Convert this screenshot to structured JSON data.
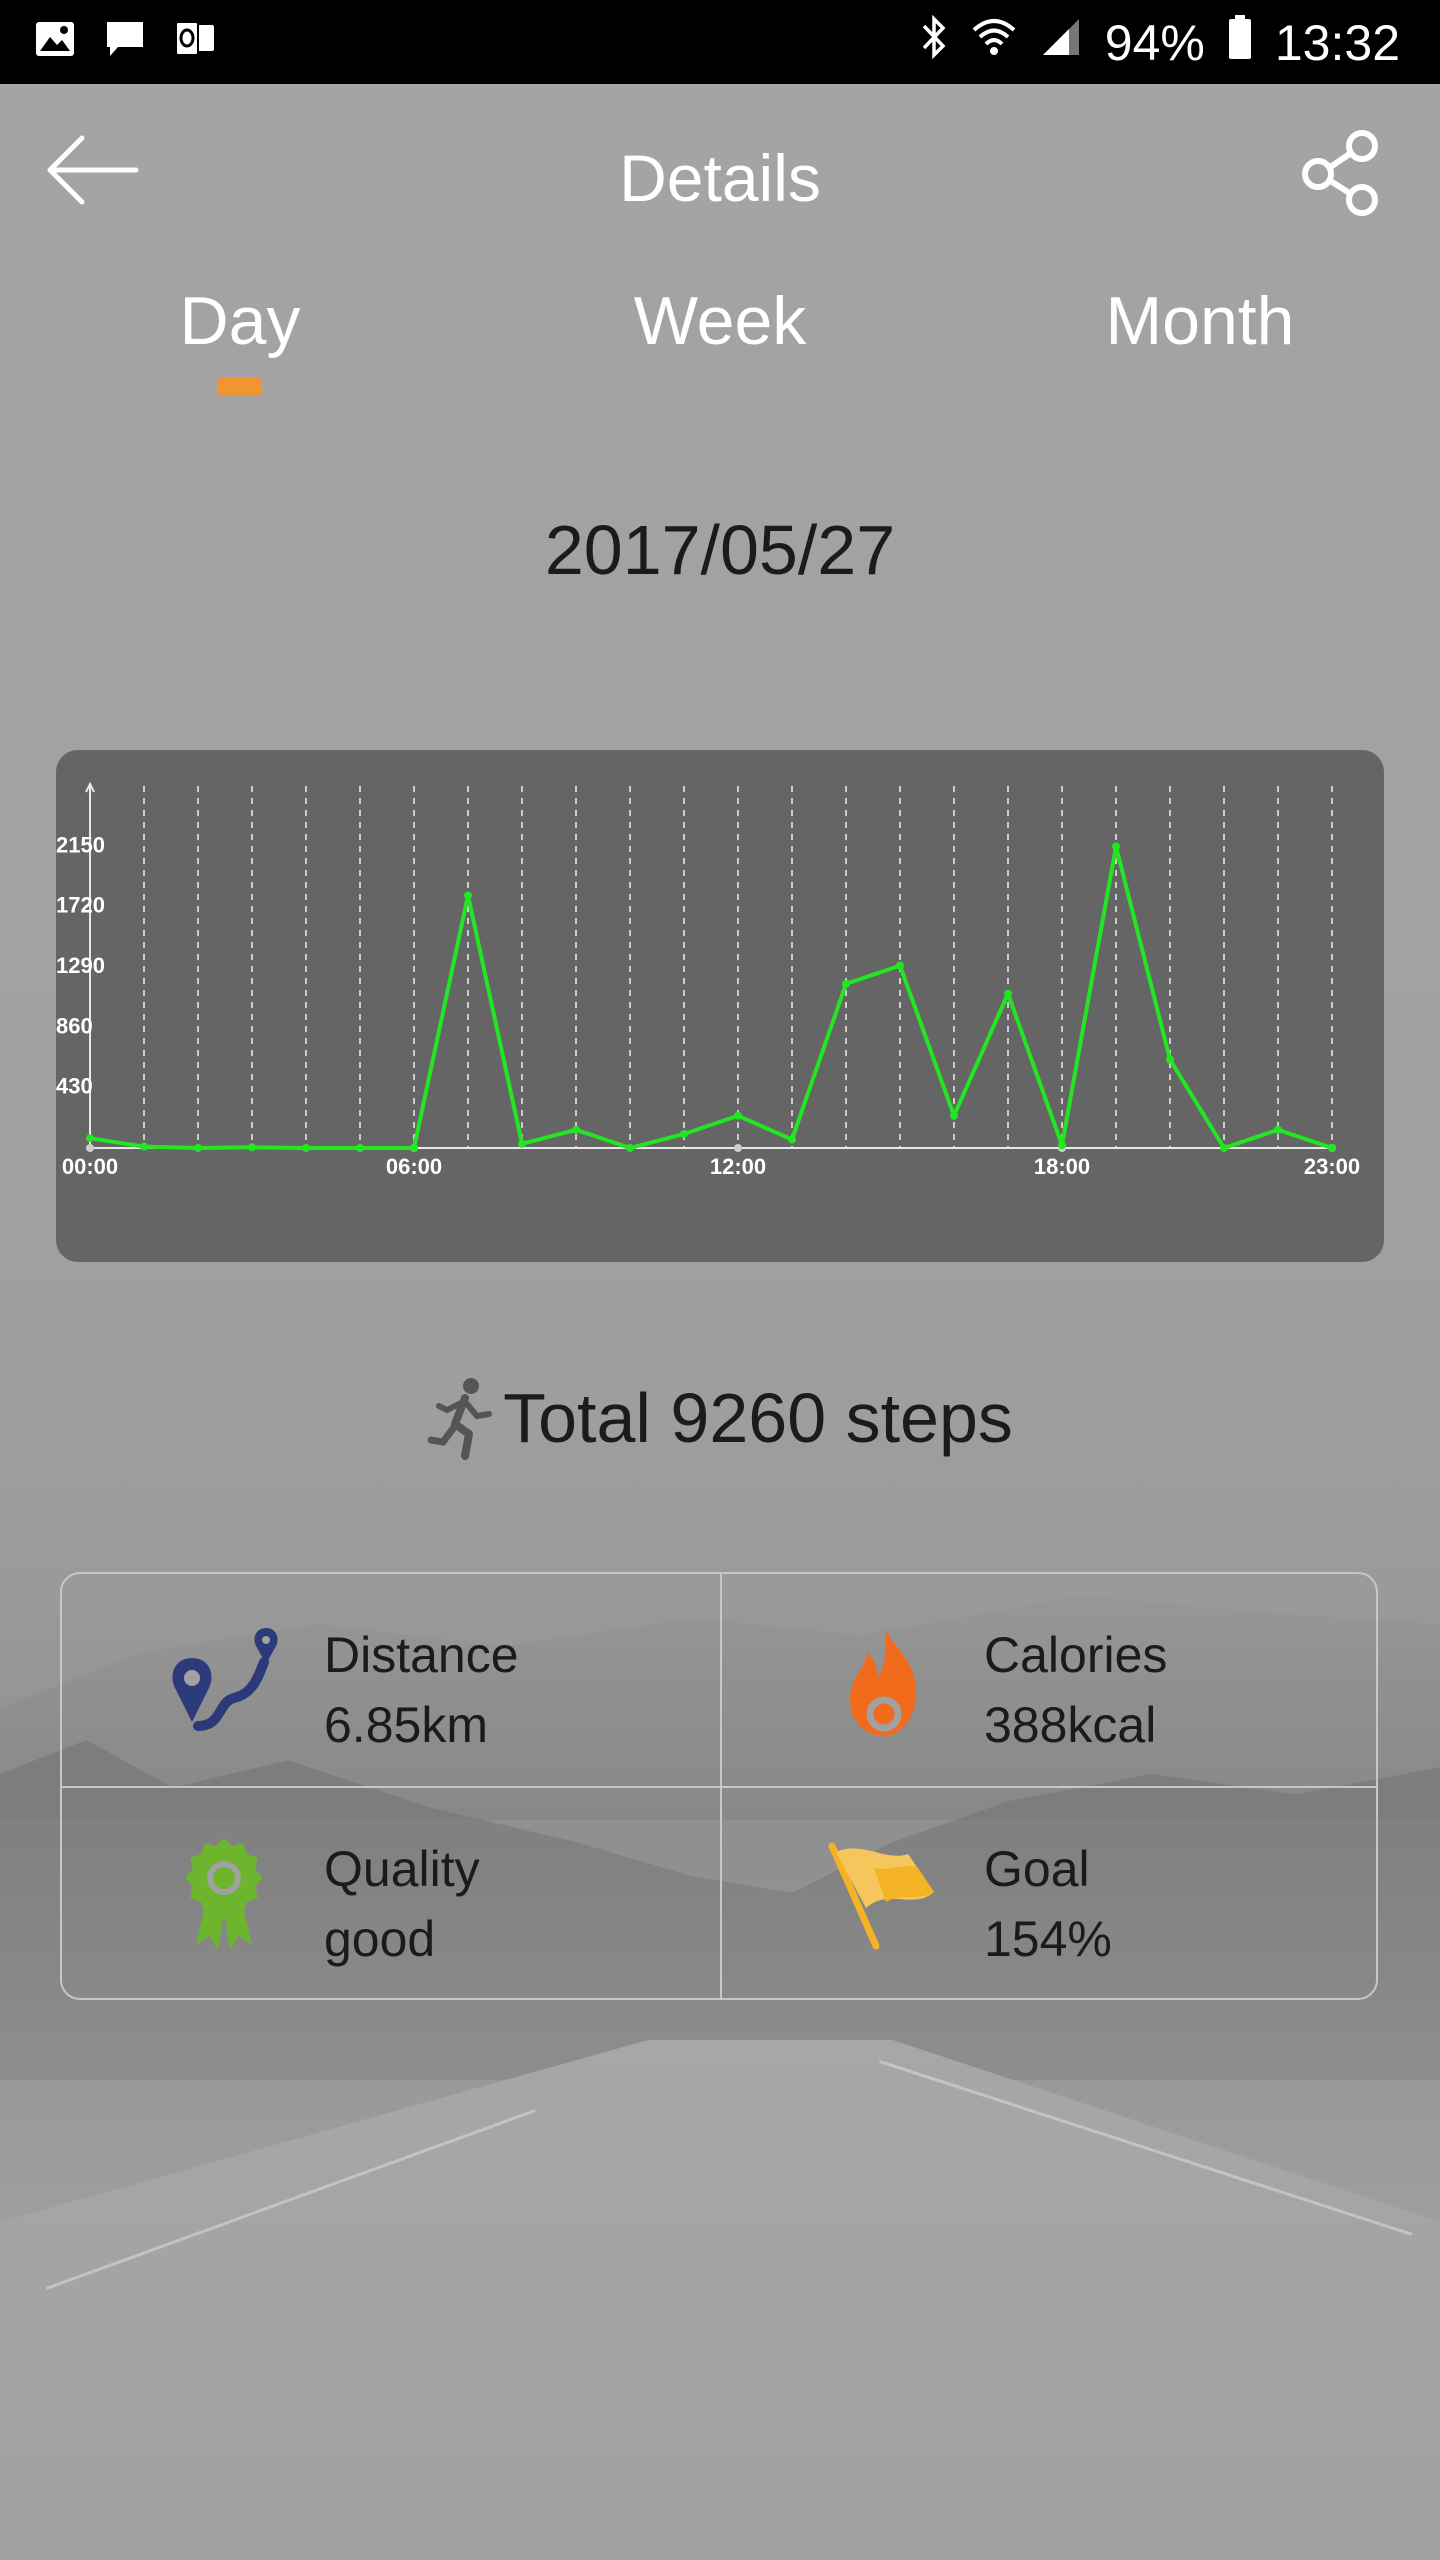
{
  "status_bar": {
    "battery": "94%",
    "time": "13:32",
    "left_icons": [
      "image-icon",
      "message-icon",
      "outlook-icon"
    ],
    "right_icons": [
      "bluetooth-icon",
      "wifi-icon",
      "signal-icon",
      "battery-icon"
    ]
  },
  "header": {
    "title": "Details"
  },
  "tabs": [
    {
      "label": "Day",
      "selected": true
    },
    {
      "label": "Week",
      "selected": false
    },
    {
      "label": "Month",
      "selected": false
    }
  ],
  "date": "2017/05/27",
  "chart_data": {
    "type": "line",
    "y_ticks": [
      "2150",
      "1720",
      "1290",
      "860",
      "430"
    ],
    "x_ticks": [
      "00:00",
      "06:00",
      "12:00",
      "18:00",
      "23:00"
    ],
    "ylim": [
      0,
      2580
    ],
    "line_color": "#22e622",
    "grid": true,
    "series": [
      {
        "x": [
          0,
          1,
          2,
          3,
          4,
          5,
          6,
          7,
          8,
          9,
          10,
          11,
          12,
          13,
          14,
          15,
          16,
          17,
          18,
          19,
          20,
          21,
          22,
          23
        ],
        "values": [
          70,
          10,
          0,
          5,
          0,
          0,
          0,
          1800,
          30,
          130,
          0,
          100,
          230,
          60,
          1170,
          1300,
          230,
          1100,
          20,
          2150,
          630,
          0,
          130,
          0
        ]
      }
    ]
  },
  "total": {
    "text": "Total 9260 steps"
  },
  "stats": {
    "distance": {
      "label": "Distance",
      "value": "6.85km"
    },
    "calories": {
      "label": "Calories",
      "value": "388kcal"
    },
    "quality": {
      "label": "Quality",
      "value": "good"
    },
    "goal": {
      "label": "Goal",
      "value": "154%"
    }
  },
  "colors": {
    "tab_indicator": "#f0952f",
    "distance_icon": "#2d3a7a",
    "calories_icon": "#f26b1d",
    "quality_icon": "#6cb52d",
    "goal_icon": "#f4b325"
  }
}
